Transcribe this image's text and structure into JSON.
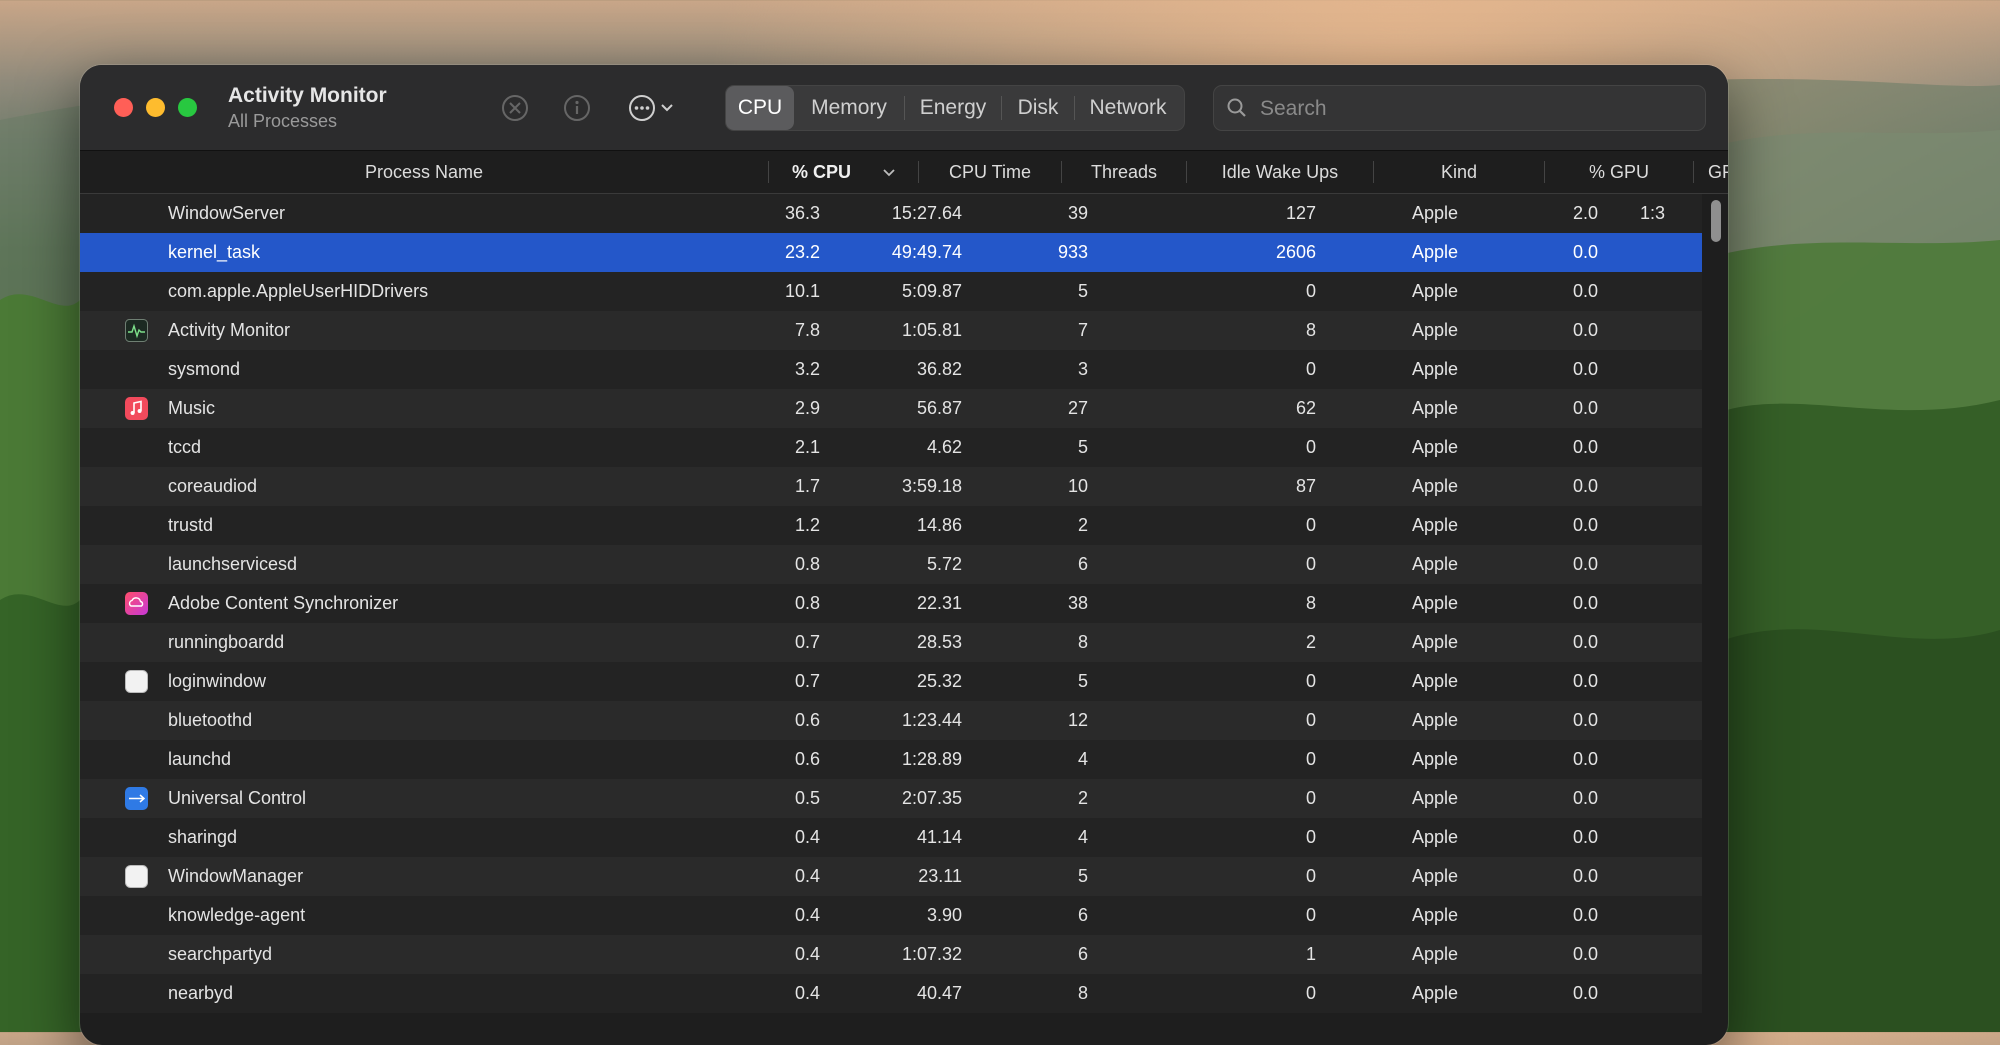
{
  "window": {
    "title": "Activity Monitor",
    "subtitle": "All Processes"
  },
  "toolbar": {
    "stop_icon": "x-circle-icon",
    "info_icon": "info-icon",
    "more_icon": "ellipsis-circle-icon"
  },
  "tabs": [
    {
      "label": "CPU",
      "active": true
    },
    {
      "label": "Memory",
      "active": false
    },
    {
      "label": "Energy",
      "active": false
    },
    {
      "label": "Disk",
      "active": false
    },
    {
      "label": "Network",
      "active": false
    }
  ],
  "search": {
    "placeholder": "Search"
  },
  "columns": {
    "name": "Process Name",
    "cpu": "% CPU",
    "cpu_time": "CPU Time",
    "threads": "Threads",
    "idle": "Idle Wake Ups",
    "kind": "Kind",
    "gpu": "% GPU",
    "gpu_time": "GPU T"
  },
  "colors": {
    "selection": "#2457c9",
    "close": "#ff5f57",
    "minimize": "#febc2e",
    "maximize": "#28c840"
  },
  "processes": [
    {
      "name": "WindowServer",
      "cpu": "36.3",
      "time": "15:27.64",
      "threads": "39",
      "idle": "127",
      "kind": "Apple",
      "gpu": "2.0",
      "gput": "1:3",
      "icon": ""
    },
    {
      "name": "kernel_task",
      "cpu": "23.2",
      "time": "49:49.74",
      "threads": "933",
      "idle": "2606",
      "kind": "Apple",
      "gpu": "0.0",
      "gput": "",
      "icon": "",
      "selected": true
    },
    {
      "name": "com.apple.AppleUserHIDDrivers",
      "cpu": "10.1",
      "time": "5:09.87",
      "threads": "5",
      "idle": "0",
      "kind": "Apple",
      "gpu": "0.0",
      "gput": "",
      "icon": ""
    },
    {
      "name": "Activity Monitor",
      "cpu": "7.8",
      "time": "1:05.81",
      "threads": "7",
      "idle": "8",
      "kind": "Apple",
      "gpu": "0.0",
      "gput": "",
      "icon": "activity-monitor-icon"
    },
    {
      "name": "sysmond",
      "cpu": "3.2",
      "time": "36.82",
      "threads": "3",
      "idle": "0",
      "kind": "Apple",
      "gpu": "0.0",
      "gput": "",
      "icon": ""
    },
    {
      "name": "Music",
      "cpu": "2.9",
      "time": "56.87",
      "threads": "27",
      "idle": "62",
      "kind": "Apple",
      "gpu": "0.0",
      "gput": "",
      "icon": "music-icon"
    },
    {
      "name": "tccd",
      "cpu": "2.1",
      "time": "4.62",
      "threads": "5",
      "idle": "0",
      "kind": "Apple",
      "gpu": "0.0",
      "gput": "",
      "icon": ""
    },
    {
      "name": "coreaudiod",
      "cpu": "1.7",
      "time": "3:59.18",
      "threads": "10",
      "idle": "87",
      "kind": "Apple",
      "gpu": "0.0",
      "gput": "",
      "icon": ""
    },
    {
      "name": "trustd",
      "cpu": "1.2",
      "time": "14.86",
      "threads": "2",
      "idle": "0",
      "kind": "Apple",
      "gpu": "0.0",
      "gput": "",
      "icon": ""
    },
    {
      "name": "launchservicesd",
      "cpu": "0.8",
      "time": "5.72",
      "threads": "6",
      "idle": "0",
      "kind": "Apple",
      "gpu": "0.0",
      "gput": "",
      "icon": ""
    },
    {
      "name": "Adobe Content Synchronizer",
      "cpu": "0.8",
      "time": "22.31",
      "threads": "38",
      "idle": "8",
      "kind": "Apple",
      "gpu": "0.0",
      "gput": "",
      "icon": "creative-cloud-icon"
    },
    {
      "name": "runningboardd",
      "cpu": "0.7",
      "time": "28.53",
      "threads": "8",
      "idle": "2",
      "kind": "Apple",
      "gpu": "0.0",
      "gput": "",
      "icon": ""
    },
    {
      "name": "loginwindow",
      "cpu": "0.7",
      "time": "25.32",
      "threads": "5",
      "idle": "0",
      "kind": "Apple",
      "gpu": "0.0",
      "gput": "",
      "icon": "generic-app-icon"
    },
    {
      "name": "bluetoothd",
      "cpu": "0.6",
      "time": "1:23.44",
      "threads": "12",
      "idle": "0",
      "kind": "Apple",
      "gpu": "0.0",
      "gput": "",
      "icon": ""
    },
    {
      "name": "launchd",
      "cpu": "0.6",
      "time": "1:28.89",
      "threads": "4",
      "idle": "0",
      "kind": "Apple",
      "gpu": "0.0",
      "gput": "",
      "icon": ""
    },
    {
      "name": "Universal Control",
      "cpu": "0.5",
      "time": "2:07.35",
      "threads": "2",
      "idle": "0",
      "kind": "Apple",
      "gpu": "0.0",
      "gput": "",
      "icon": "universal-control-icon"
    },
    {
      "name": "sharingd",
      "cpu": "0.4",
      "time": "41.14",
      "threads": "4",
      "idle": "0",
      "kind": "Apple",
      "gpu": "0.0",
      "gput": "",
      "icon": ""
    },
    {
      "name": "WindowManager",
      "cpu": "0.4",
      "time": "23.11",
      "threads": "5",
      "idle": "0",
      "kind": "Apple",
      "gpu": "0.0",
      "gput": "",
      "icon": "generic-app-icon"
    },
    {
      "name": "knowledge-agent",
      "cpu": "0.4",
      "time": "3.90",
      "threads": "6",
      "idle": "0",
      "kind": "Apple",
      "gpu": "0.0",
      "gput": "",
      "icon": ""
    },
    {
      "name": "searchpartyd",
      "cpu": "0.4",
      "time": "1:07.32",
      "threads": "6",
      "idle": "1",
      "kind": "Apple",
      "gpu": "0.0",
      "gput": "",
      "icon": ""
    },
    {
      "name": "nearbyd",
      "cpu": "0.4",
      "time": "40.47",
      "threads": "8",
      "idle": "0",
      "kind": "Apple",
      "gpu": "0.0",
      "gput": "",
      "icon": ""
    }
  ]
}
